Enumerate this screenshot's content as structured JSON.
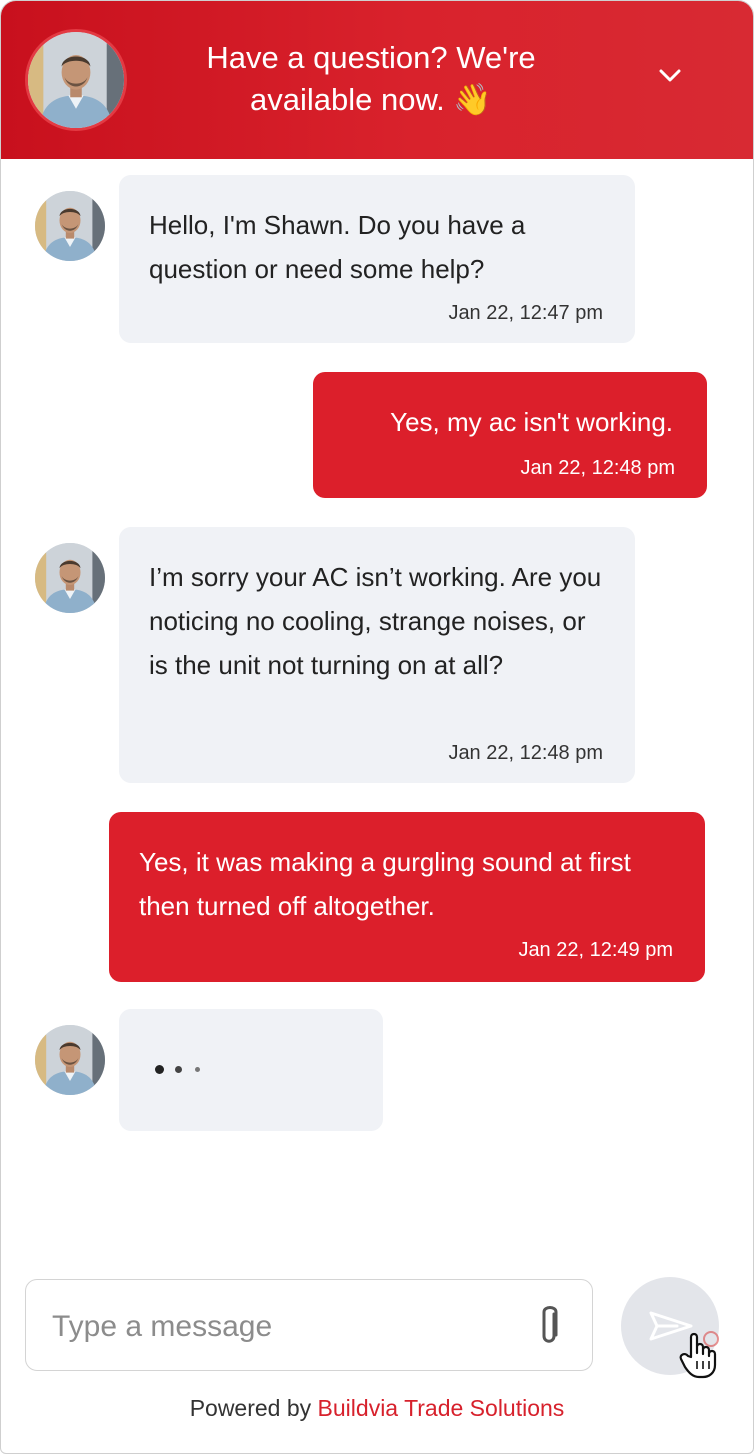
{
  "header": {
    "title": "Have a question? We're available now. 👋",
    "collapse_icon": "chevron-down-icon"
  },
  "messages": [
    {
      "from": "agent",
      "text": "Hello, I'm Shawn. Do you have a question or need some help?",
      "time": "Jan 22, 12:47 pm"
    },
    {
      "from": "user",
      "text": "Yes, my ac isn't working.",
      "time": "Jan 22, 12:48 pm"
    },
    {
      "from": "agent",
      "text": "I’m sorry your AC isn’t working. Are you noticing no cooling, strange noises, or is the unit not turning on at all?",
      "time": "Jan 22, 12:48 pm"
    },
    {
      "from": "user",
      "text": "Yes, it was making a gurgling sound at first then turned off altogether.",
      "time": "Jan 22, 12:49 pm"
    }
  ],
  "typing_indicator": "typing-dots",
  "composer": {
    "placeholder": "Type a message",
    "value": "",
    "attach_icon": "paperclip-icon",
    "send_icon": "send-icon"
  },
  "footer": {
    "powered_by": "Powered by",
    "brand": "Buildvia Trade Solutions"
  },
  "colors": {
    "accent": "#dc1f2b",
    "agent_bubble": "#f0f2f6",
    "send_button": "#e3e5ea"
  }
}
